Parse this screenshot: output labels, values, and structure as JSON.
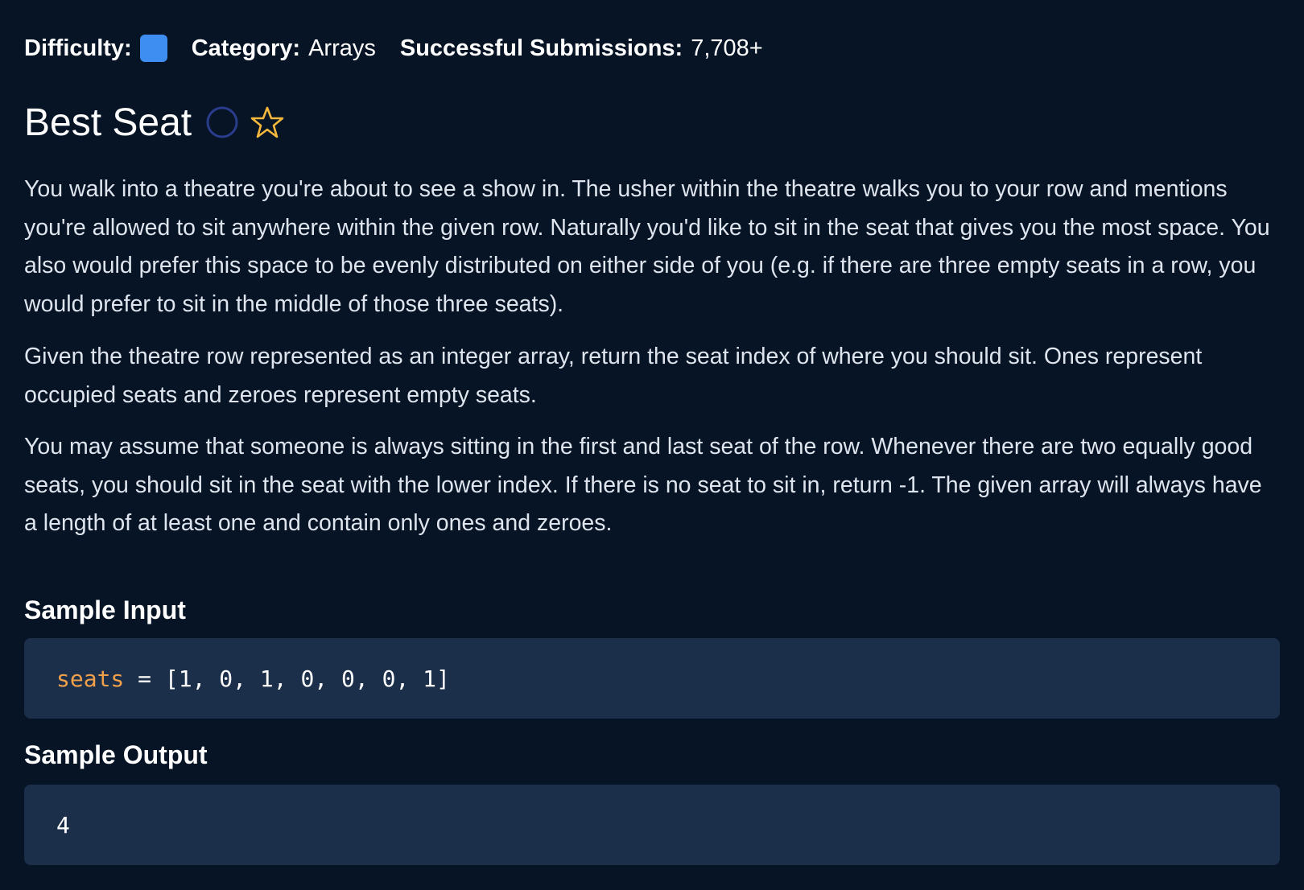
{
  "meta": {
    "difficulty_label": "Difficulty:",
    "category_label": "Category:",
    "category_value": "Arrays",
    "submissions_label": "Successful Submissions:",
    "submissions_value": "7,708+",
    "difficulty_color": "#3d8ef0"
  },
  "question": {
    "title": "Best Seat",
    "icons": [
      "circle-icon",
      "star-icon"
    ],
    "paragraphs": [
      "You walk into a theatre you're about to see a show in. The usher within the theatre walks you to your row and mentions you're allowed to sit anywhere within the given row. Naturally you'd like to sit in the seat that gives you the most space. You also would prefer this space to be evenly distributed on either side of you (e.g. if there are three empty seats in a row, you would prefer to sit in the middle of those three seats).",
      "Given the theatre row represented as an integer array, return the seat index of where you should sit. Ones represent occupied seats and zeroes represent empty seats.",
      "You may assume that someone is always sitting in the first and last seat of the row. Whenever there are two equally good seats, you should sit in the seat with the lower index. If there is no seat to sit in, return -1. The given array will always have a length of at least one and contain only ones and zeroes."
    ]
  },
  "sample_input": {
    "heading": "Sample Input",
    "variable": "seats",
    "rest": " = [1, 0, 1, 0, 0, 0, 1]"
  },
  "sample_output": {
    "heading": "Sample Output",
    "value": "4"
  },
  "colors": {
    "background": "#061425",
    "code_background": "#1c2f4a",
    "variable": "#f0a04b",
    "star": "#f5b83d",
    "circle": "#2b3c8c"
  }
}
